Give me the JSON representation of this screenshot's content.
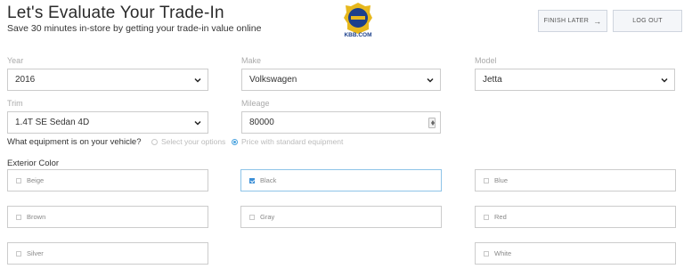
{
  "header": {
    "title": "Let's Evaluate Your Trade-In",
    "subtitle": "Save 30 minutes in-store by getting your trade-in value online",
    "logo_text": "KBB.COM",
    "finish_later_label": "FINISH LATER",
    "finish_later_icon": "arrow-right-icon",
    "logout_label": "LOG OUT"
  },
  "vehicle": {
    "year": {
      "label": "Year",
      "value": "2016"
    },
    "make": {
      "label": "Make",
      "value": "Volkswagen"
    },
    "model": {
      "label": "Model",
      "value": "Jetta"
    },
    "trim": {
      "label": "Trim",
      "value": "1.4T SE Sedan 4D"
    },
    "mileage": {
      "label": "Mileage",
      "value": "80000"
    }
  },
  "equipment": {
    "question": "What equipment is on your vehicle?",
    "options": [
      {
        "label": "Select your options",
        "selected": false
      },
      {
        "label": "Price with standard equipment",
        "selected": true
      }
    ]
  },
  "exterior": {
    "label": "Exterior Color",
    "colors": [
      {
        "label": "Beige",
        "checked": false
      },
      {
        "label": "Black",
        "checked": true
      },
      {
        "label": "Blue",
        "checked": false
      },
      {
        "label": "Brown",
        "checked": false
      },
      {
        "label": "Gray",
        "checked": false
      },
      {
        "label": "Red",
        "checked": false
      },
      {
        "label": "Silver",
        "checked": false
      },
      {
        "label": "White",
        "checked": false
      }
    ]
  },
  "colors": {
    "accent": "#3a8ed6",
    "border": "#cccccc",
    "label": "#aaaaaa"
  }
}
